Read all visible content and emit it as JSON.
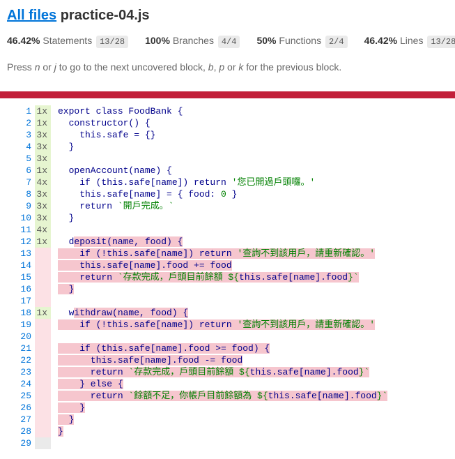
{
  "header": {
    "all_files_link": "All files",
    "file_name": "practice-04.js"
  },
  "summary": [
    {
      "pct": "46.42%",
      "label": "Statements",
      "frac": "13/28"
    },
    {
      "pct": "100%",
      "label": "Branches",
      "frac": "4/4"
    },
    {
      "pct": "50%",
      "label": "Functions",
      "frac": "2/4"
    },
    {
      "pct": "46.42%",
      "label": "Lines",
      "frac": "13/28"
    }
  ],
  "hint": {
    "text_1": "Press ",
    "key_n": "n",
    "text_2": " or ",
    "key_j": "j",
    "text_3": " to go to the next uncovered block, ",
    "key_b": "b",
    "text_4": ", ",
    "key_p": "p",
    "text_5": " or ",
    "key_k": "k",
    "text_6": " for the previous block."
  },
  "colors": {
    "status_bar": "#c21f39",
    "covered_hits": "#e6f5d0",
    "uncovered_hits": "#fce1e5",
    "uncovered_code": "#f6c6ce",
    "link": "#0074d9"
  },
  "lines": [
    {
      "n": "1",
      "hits": "1x",
      "cov": "y",
      "segs": [
        {
          "t": "export class FoodBank {",
          "c": "kw"
        }
      ]
    },
    {
      "n": "2",
      "hits": "1x",
      "cov": "y",
      "segs": [
        {
          "t": "  constructor() {",
          "c": "kw"
        }
      ]
    },
    {
      "n": "3",
      "hits": "3x",
      "cov": "y",
      "segs": [
        {
          "t": "    this.safe = {}",
          "c": "kw"
        }
      ]
    },
    {
      "n": "4",
      "hits": "3x",
      "cov": "y",
      "segs": [
        {
          "t": "  }",
          "c": "kw"
        }
      ]
    },
    {
      "n": "5",
      "hits": "3x",
      "cov": "y",
      "segs": [
        {
          "t": "",
          "c": "plain"
        }
      ]
    },
    {
      "n": "6",
      "hits": "1x",
      "cov": "y",
      "segs": [
        {
          "t": "  openAccount(name) {",
          "c": "kw"
        }
      ]
    },
    {
      "n": "7",
      "hits": "4x",
      "cov": "y",
      "segs": [
        {
          "t": "    if (this.safe[name]) return ",
          "c": "kw"
        },
        {
          "t": "'您已開過戶頭囉。'",
          "c": "str"
        }
      ]
    },
    {
      "n": "8",
      "hits": "3x",
      "cov": "y",
      "segs": [
        {
          "t": "    this.safe[name] = { food: ",
          "c": "kw"
        },
        {
          "t": "0",
          "c": "num"
        },
        {
          "t": " }",
          "c": "kw"
        }
      ]
    },
    {
      "n": "9",
      "hits": "3x",
      "cov": "y",
      "segs": [
        {
          "t": "    return ",
          "c": "kw"
        },
        {
          "t": "`開戶完成。`",
          "c": "str"
        }
      ]
    },
    {
      "n": "10",
      "hits": "3x",
      "cov": "y",
      "segs": [
        {
          "t": "  }",
          "c": "kw"
        }
      ]
    },
    {
      "n": "11",
      "hits": "4x",
      "cov": "y",
      "segs": [
        {
          "t": "",
          "c": "plain"
        }
      ]
    },
    {
      "n": "12",
      "hits": "1x",
      "cov": "y",
      "segs": [
        {
          "t": "  d",
          "c": "kw"
        },
        {
          "t": "eposit(name, food) {",
          "c": "kw",
          "miss": true
        }
      ]
    },
    {
      "n": "13",
      "hits": "",
      "cov": "n",
      "segs": [
        {
          "t": "    if (!this.safe[name]) return ",
          "c": "kw",
          "miss": true
        },
        {
          "t": "'查詢不到該用戶，請重新確認。'",
          "c": "str",
          "miss": true
        }
      ]
    },
    {
      "n": "14",
      "hits": "",
      "cov": "n",
      "segs": [
        {
          "t": "    this.safe[name].food += food",
          "c": "kw",
          "miss": true
        }
      ]
    },
    {
      "n": "15",
      "hits": "",
      "cov": "n",
      "segs": [
        {
          "t": "    return ",
          "c": "kw",
          "miss": true
        },
        {
          "t": "`存款完成，戶頭目前餘額 ${",
          "c": "str",
          "miss": true
        },
        {
          "t": "this.safe[name].food",
          "c": "kw",
          "miss": true
        },
        {
          "t": "}`",
          "c": "str",
          "miss": true
        }
      ]
    },
    {
      "n": "16",
      "hits": "",
      "cov": "n",
      "segs": [
        {
          "t": "  }",
          "c": "kw",
          "miss": true
        }
      ]
    },
    {
      "n": "17",
      "hits": "",
      "cov": "n",
      "segs": [
        {
          "t": "",
          "c": "plain"
        }
      ]
    },
    {
      "n": "18",
      "hits": "1x",
      "cov": "y",
      "segs": [
        {
          "t": "  w",
          "c": "kw"
        },
        {
          "t": "ithdraw(name, food) {",
          "c": "kw",
          "miss": true
        }
      ]
    },
    {
      "n": "19",
      "hits": "",
      "cov": "n",
      "segs": [
        {
          "t": "    if (!this.safe[name]) return ",
          "c": "kw",
          "miss": true
        },
        {
          "t": "'查詢不到該用戶，請重新確認。'",
          "c": "str",
          "miss": true
        }
      ]
    },
    {
      "n": "20",
      "hits": "",
      "cov": "n",
      "segs": [
        {
          "t": "",
          "c": "plain"
        }
      ]
    },
    {
      "n": "21",
      "hits": "",
      "cov": "n",
      "segs": [
        {
          "t": "    if (this.safe[name].food >= food) {",
          "c": "kw",
          "miss": true
        }
      ]
    },
    {
      "n": "22",
      "hits": "",
      "cov": "n",
      "segs": [
        {
          "t": "      this.safe[name].food -= food",
          "c": "kw",
          "miss": true
        }
      ]
    },
    {
      "n": "23",
      "hits": "",
      "cov": "n",
      "segs": [
        {
          "t": "      return ",
          "c": "kw",
          "miss": true
        },
        {
          "t": "`存款完成，戶頭目前餘額 ${",
          "c": "str",
          "miss": true
        },
        {
          "t": "this.safe[name].food",
          "c": "kw",
          "miss": true
        },
        {
          "t": "}`",
          "c": "str",
          "miss": true
        }
      ]
    },
    {
      "n": "24",
      "hits": "",
      "cov": "n",
      "segs": [
        {
          "t": "    } else {",
          "c": "kw",
          "miss": true
        }
      ]
    },
    {
      "n": "25",
      "hits": "",
      "cov": "n",
      "segs": [
        {
          "t": "      return ",
          "c": "kw",
          "miss": true
        },
        {
          "t": "`餘額不足，你帳戶目前餘額為 ${",
          "c": "str",
          "miss": true
        },
        {
          "t": "this.safe[name].food",
          "c": "kw",
          "miss": true
        },
        {
          "t": "}`",
          "c": "str",
          "miss": true
        }
      ]
    },
    {
      "n": "26",
      "hits": "",
      "cov": "n",
      "segs": [
        {
          "t": "    }",
          "c": "kw",
          "miss": true
        }
      ]
    },
    {
      "n": "27",
      "hits": "",
      "cov": "n",
      "segs": [
        {
          "t": "  }",
          "c": "kw",
          "miss": true
        }
      ]
    },
    {
      "n": "28",
      "hits": "",
      "cov": "n",
      "segs": [
        {
          "t": "}",
          "c": "kw",
          "miss": true
        }
      ]
    },
    {
      "n": "29",
      "hits": "",
      "cov": "e",
      "segs": [
        {
          "t": "",
          "c": "plain"
        }
      ]
    }
  ]
}
